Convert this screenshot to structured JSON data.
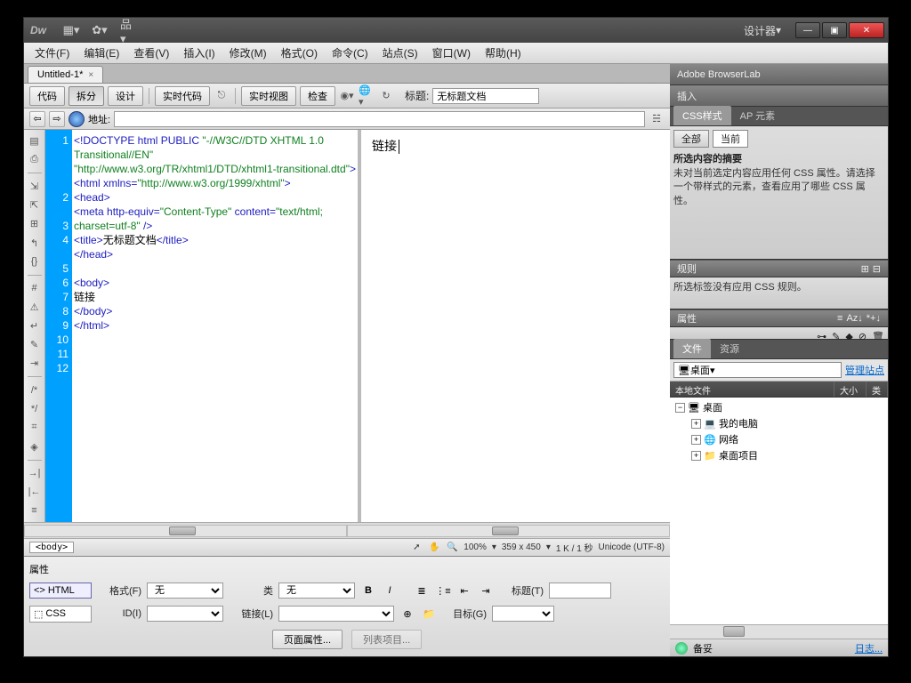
{
  "titleBar": {
    "logo": "Dw",
    "designer": "设计器",
    "minimize": "—",
    "maximize": "▣",
    "close": "✕"
  },
  "menuBar": [
    "文件(F)",
    "编辑(E)",
    "查看(V)",
    "插入(I)",
    "修改(M)",
    "格式(O)",
    "命令(C)",
    "站点(S)",
    "窗口(W)",
    "帮助(H)"
  ],
  "docTab": {
    "name": "Untitled-1*",
    "close": "×"
  },
  "docToolbar": {
    "code": "代码",
    "split": "拆分",
    "design": "设计",
    "liveCode": "实时代码",
    "liveView": "实时视图",
    "inspect": "检查",
    "titleLabel": "标题:",
    "titleValue": "无标题文档"
  },
  "addrBar": {
    "back": "⇦",
    "fwd": "⇨",
    "label": "地址:",
    "value": ""
  },
  "code": {
    "lines": [
      "1",
      "2",
      "3",
      "4",
      "5",
      "6",
      "7",
      "8",
      "9",
      "10",
      "11",
      "12"
    ],
    "l1a": "<!DOCTYPE html PUBLIC ",
    "l1b": "\"-//W3C//DTD XHTML 1.0 Transitional//EN\" \"http://www.w3.org/TR/xhtml1/DTD/xhtml1-transitional.dtd\"",
    "l1c": ">",
    "l2a": "<html ",
    "l2b": "xmlns=",
    "l2c": "\"http://www.w3.org/1999/xhtml\"",
    "l2d": ">",
    "l3": "<head>",
    "l4a": "<meta ",
    "l4b": "http-equiv=",
    "l4c": "\"Content-Type\"",
    "l4d": " content=",
    "l4e": "\"text/html; charset=utf-8\"",
    "l4f": " />",
    "l5a": "<title>",
    "l5b": "无标题文档",
    "l5c": "</title>",
    "l6": "</head>",
    "l7": "",
    "l8": "<body>",
    "l9": "链接",
    "l10": "</body>",
    "l11": "</html>",
    "l12": ""
  },
  "designPane": {
    "text": "链接"
  },
  "tagSelector": {
    "crumb": "<body>"
  },
  "status": {
    "zoom": "100%",
    "dims": "359 x 450",
    "size": "1 K / 1 秒",
    "encoding": "Unicode (UTF-8)"
  },
  "propInspector": {
    "title": "属性",
    "html": "HTML",
    "css": "CSS",
    "formatLabel": "格式(F)",
    "formatValue": "无",
    "classLabel": "类",
    "classValue": "无",
    "idLabel": "ID(I)",
    "idValue": "",
    "linkLabel": "链接(L)",
    "linkValue": "",
    "titleLabel2": "标题(T)",
    "targetLabel": "目标(G)",
    "bold": "B",
    "italic": "I",
    "pageProps": "页面属性...",
    "listItem": "列表项目..."
  },
  "panels": {
    "browserLab": "Adobe BrowserLab",
    "insert": "插入",
    "cssTab": "CSS样式",
    "apTab": "AP 元素",
    "allBtn": "全部",
    "currentBtn": "当前",
    "summaryTitle": "所选内容的摘要",
    "summaryText": "未对当前选定内容应用任何 CSS 属性。请选择一个带样式的元素，查看应用了哪些 CSS 属性。",
    "rulesTitle": "规则",
    "rulesText": "所选标签没有应用 CSS 规则。",
    "propsTitle": "属性",
    "filesTab": "文件",
    "assetsTab": "资源",
    "desktopLoc": "桌面",
    "manageSites": "管理站点",
    "colLocal": "本地文件",
    "colSize": "大小",
    "colType": "类",
    "tree": {
      "desktop": "桌面",
      "myComputer": "我的电脑",
      "network": "网络",
      "desktopItems": "桌面项目"
    },
    "ready": "备妥",
    "log": "日志..."
  }
}
